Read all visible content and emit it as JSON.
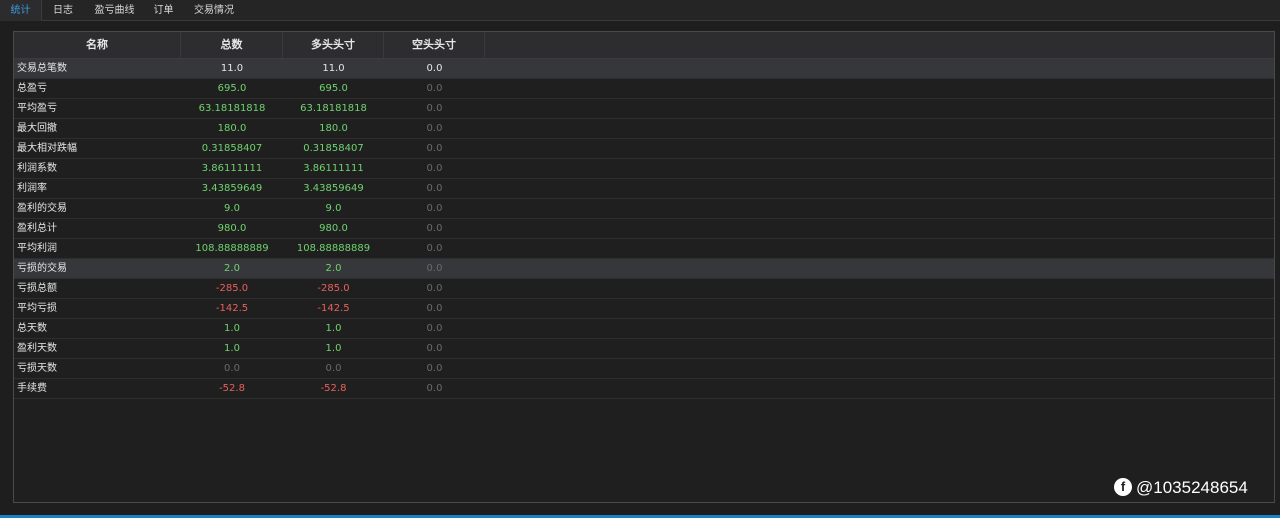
{
  "tabs": [
    {
      "label": "统计",
      "active": true
    },
    {
      "label": "日志",
      "active": false
    },
    {
      "label": "盈亏曲线",
      "active": false
    },
    {
      "label": "订单",
      "active": false
    },
    {
      "label": "交易情况",
      "active": false
    }
  ],
  "table": {
    "headers": [
      "名称",
      "总数",
      "多头头寸",
      "空头头寸"
    ],
    "rows": [
      {
        "name": "交易总笔数",
        "total": "11.0",
        "long": "11.0",
        "short": "0.0",
        "highlight": true,
        "color": "#e6e6e6",
        "short_color": "#e6e6e6"
      },
      {
        "name": "总盈亏",
        "total": "695.0",
        "long": "695.0",
        "short": "0.0",
        "highlight": false,
        "color": "#6fd36f",
        "short_color": "#6a6a6a"
      },
      {
        "name": "平均盈亏",
        "total": "63.18181818",
        "long": "63.18181818",
        "short": "0.0",
        "highlight": false,
        "color": "#6fd36f",
        "short_color": "#6a6a6a"
      },
      {
        "name": "最大回撤",
        "total": "180.0",
        "long": "180.0",
        "short": "0.0",
        "highlight": false,
        "color": "#6fd36f",
        "short_color": "#6a6a6a"
      },
      {
        "name": "最大相对跌幅",
        "total": "0.31858407",
        "long": "0.31858407",
        "short": "0.0",
        "highlight": false,
        "color": "#6fd36f",
        "short_color": "#6a6a6a"
      },
      {
        "name": "利润系数",
        "total": "3.86111111",
        "long": "3.86111111",
        "short": "0.0",
        "highlight": false,
        "color": "#6fd36f",
        "short_color": "#6a6a6a"
      },
      {
        "name": "利润率",
        "total": "3.43859649",
        "long": "3.43859649",
        "short": "0.0",
        "highlight": false,
        "color": "#6fd36f",
        "short_color": "#6a6a6a"
      },
      {
        "name": "盈利的交易",
        "total": "9.0",
        "long": "9.0",
        "short": "0.0",
        "highlight": false,
        "color": "#6fd36f",
        "short_color": "#6a6a6a"
      },
      {
        "name": "盈利总计",
        "total": "980.0",
        "long": "980.0",
        "short": "0.0",
        "highlight": false,
        "color": "#6fd36f",
        "short_color": "#6a6a6a"
      },
      {
        "name": "平均利润",
        "total": "108.88888889",
        "long": "108.88888889",
        "short": "0.0",
        "highlight": false,
        "color": "#6fd36f",
        "short_color": "#6a6a6a"
      },
      {
        "name": "亏损的交易",
        "total": "2.0",
        "long": "2.0",
        "short": "0.0",
        "highlight": true,
        "color": "#6fd36f",
        "short_color": "#6a6a6a"
      },
      {
        "name": "亏损总额",
        "total": "-285.0",
        "long": "-285.0",
        "short": "0.0",
        "highlight": false,
        "color": "#e8605a",
        "short_color": "#6a6a6a"
      },
      {
        "name": "平均亏损",
        "total": "-142.5",
        "long": "-142.5",
        "short": "0.0",
        "highlight": false,
        "color": "#e8605a",
        "short_color": "#6a6a6a"
      },
      {
        "name": "总天数",
        "total": "1.0",
        "long": "1.0",
        "short": "0.0",
        "highlight": false,
        "color": "#6fd36f",
        "short_color": "#6a6a6a"
      },
      {
        "name": "盈利天数",
        "total": "1.0",
        "long": "1.0",
        "short": "0.0",
        "highlight": false,
        "color": "#6fd36f",
        "short_color": "#6a6a6a"
      },
      {
        "name": "亏损天数",
        "total": "0.0",
        "long": "0.0",
        "short": "0.0",
        "highlight": false,
        "color": "#6a6a6a",
        "short_color": "#6a6a6a"
      },
      {
        "name": "手续费",
        "total": "-52.8",
        "long": "-52.8",
        "short": "0.0",
        "highlight": false,
        "color": "#e8605a",
        "short_color": "#6a6a6a"
      }
    ]
  },
  "watermark": {
    "text": "@1035248654",
    "icon": "social-f-icon"
  },
  "colors": {
    "accent": "#3d9be0",
    "positive": "#6fd36f",
    "negative": "#e8605a",
    "muted": "#6a6a6a",
    "bottom_bar": "#1e7fc4"
  }
}
